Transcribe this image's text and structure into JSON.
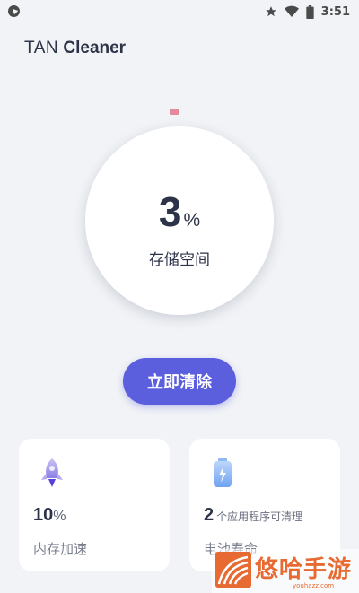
{
  "status_bar": {
    "time": "3:51",
    "icons": [
      "app-notification-icon",
      "star-icon",
      "wifi-icon",
      "battery-icon"
    ]
  },
  "app": {
    "title_light": "TAN",
    "title_bold": "Cleaner"
  },
  "storage": {
    "percent_value": "3",
    "percent_unit": "%",
    "label": "存储空间"
  },
  "clean_button": {
    "label": "立即清除"
  },
  "cards": {
    "memory": {
      "icon": "rocket-icon",
      "value": "10",
      "unit": "%",
      "label": "内存加速"
    },
    "battery": {
      "icon": "battery-charge-icon",
      "value": "2",
      "suffix": "个应用程序可清理",
      "label": "电池寿命"
    }
  },
  "watermark": {
    "text": "悠哈手游",
    "sub": "youhazz.com"
  },
  "colors": {
    "background": "#f1f3f6",
    "accent": "#5b5fde",
    "text_dark": "#2d3348",
    "watermark": "#e66a32"
  }
}
